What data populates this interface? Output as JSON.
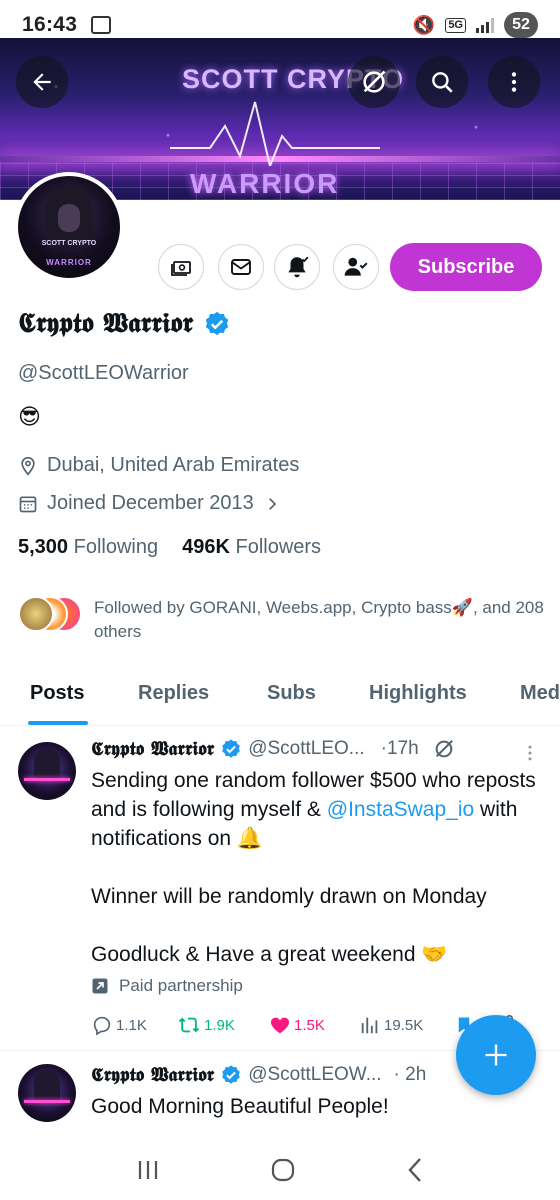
{
  "status_bar": {
    "time": "16:43",
    "network": "5G",
    "battery": "52"
  },
  "banner": {
    "line1": "SCOTT CRYPTO",
    "line2": "WARRIOR"
  },
  "header": {
    "back_icon": "arrow-left-icon",
    "grok_icon": "slash-circle-icon",
    "search_icon": "search-icon",
    "more_icon": "more-vertical-icon"
  },
  "profile": {
    "avatar_line1": "SCOTT CRYPTO",
    "avatar_line2": "WARRIOR",
    "name": "𝕮𝖗𝖞𝖕𝖙𝖔 𝖂𝖆𝖗𝖗𝖎𝖔𝖗",
    "handle": "@ScottLEOWarrior",
    "bio": "😎",
    "location": "Dubai, United Arab Emirates",
    "joined": "Joined December 2013",
    "following_count": "5,300",
    "following_label": "Following",
    "followers_count": "496K",
    "followers_label": "Followers",
    "followed_by": "Followed by GORANI, Weebs.app, Crypto bass🚀, and 208 others",
    "subscribe_label": "Subscribe",
    "brand_color": "#c135d5",
    "accent_color": "#1d9bf0"
  },
  "tabs": [
    {
      "label": "Posts",
      "active": true
    },
    {
      "label": "Replies",
      "active": false
    },
    {
      "label": "Subs",
      "active": false
    },
    {
      "label": "Highlights",
      "active": false
    },
    {
      "label": "Med",
      "active": false
    }
  ],
  "posts": [
    {
      "name": "𝕮𝖗𝖞𝖕𝖙𝖔 𝖂𝖆𝖗𝖗𝖎𝖔𝖗",
      "handle": "@ScottLEO...",
      "time": "·17h",
      "text_1": "Sending one random follower $500 who reposts and is following myself &",
      "mention": "@InstaSwap_io",
      "text_2": "with notifications on 🔔",
      "text_3": "Winner will be randomly drawn on Monday",
      "text_4": "Goodluck & Have a great weekend 🤝",
      "paid_label": "Paid partnership",
      "replies": "1.1K",
      "reposts": "1.9K",
      "likes": "1.5K",
      "views": "19.5K"
    },
    {
      "name": "𝕮𝖗𝖞𝖕𝖙𝖔 𝖂𝖆𝖗𝖗𝖎𝖔𝖗",
      "handle": "@ScottLEOW...",
      "time": "· 2h",
      "text_1": "Good Morning Beautiful People!"
    }
  ]
}
